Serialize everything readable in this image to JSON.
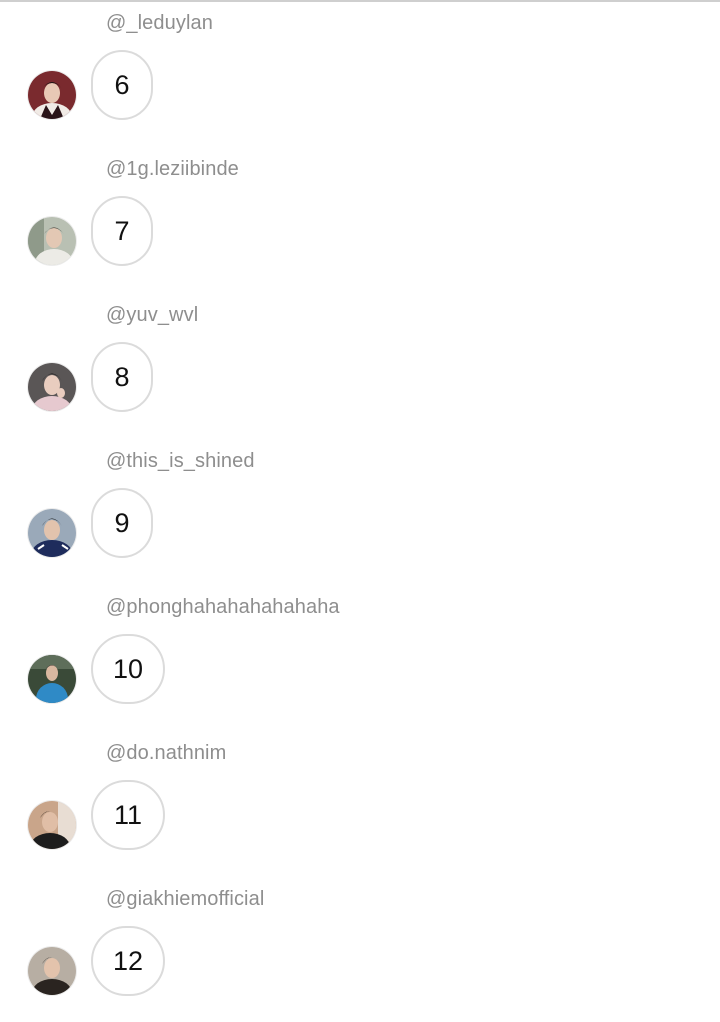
{
  "messages": [
    {
      "username": "@_leduylan",
      "text": "6",
      "avatar": {
        "bg": "#7a2a2e",
        "skin": "#e8c9b5",
        "hair": "#1b1414",
        "shirt": "#f1ebe6"
      }
    },
    {
      "username": "@1g.leziibinde",
      "text": "7",
      "avatar": {
        "bg": "#b9c0b3",
        "skin": "#e3c8b4",
        "hair": "#2a2420",
        "shirt": "#ecebe6"
      }
    },
    {
      "username": "@yuv_wvl",
      "text": "8",
      "avatar": {
        "bg": "#5a5656",
        "skin": "#e9cdbf",
        "hair": "#151212",
        "shirt": "#e6c9cf"
      }
    },
    {
      "username": "@this_is_shined",
      "text": "9",
      "avatar": {
        "bg": "#9aa9b9",
        "skin": "#e2c3ad",
        "hair": "#111111",
        "shirt": "#1e2c5c"
      }
    },
    {
      "username": "@phonghahahahahahaha",
      "text": "10",
      "avatar": {
        "bg": "#3a4a38",
        "skin": "#d9b8a0",
        "hair": "#3a3330",
        "shirt": "#2f8ac6"
      }
    },
    {
      "username": "@do.nathnim",
      "text": "11",
      "avatar": {
        "bg": "#c9a58a",
        "skin": "#e0bea6",
        "hair": "#1a1412",
        "shirt": "#1d1d1d"
      }
    },
    {
      "username": "@giakhiemofficial",
      "text": "12",
      "avatar": {
        "bg": "#b7aea3",
        "skin": "#e3c3ac",
        "hair": "#2b211c",
        "shirt": "#2a2420"
      }
    }
  ]
}
